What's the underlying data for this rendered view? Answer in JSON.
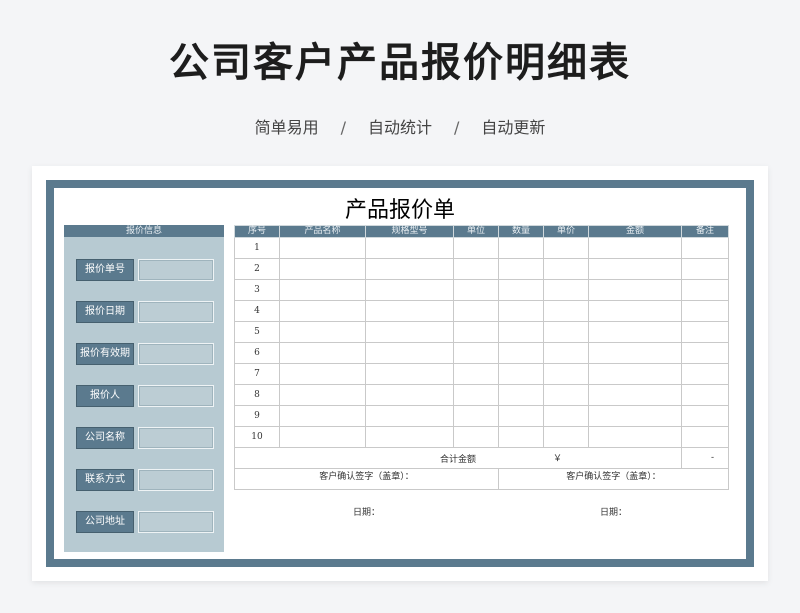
{
  "header": {
    "title": "公司客户产品报价明细表",
    "tags": [
      "简单易用",
      "自动统计",
      "自动更新"
    ],
    "separator": "/"
  },
  "sheet": {
    "title": "产品报价单",
    "info_panel": {
      "heading": "报价信息",
      "fields": [
        {
          "label": "报价单号",
          "value": ""
        },
        {
          "label": "报价日期",
          "value": ""
        },
        {
          "label": "报价有效期",
          "value": ""
        },
        {
          "label": "报价人",
          "value": ""
        },
        {
          "label": "公司名称",
          "value": ""
        },
        {
          "label": "联系方式",
          "value": ""
        },
        {
          "label": "公司地址",
          "value": ""
        }
      ]
    },
    "table": {
      "columns": [
        "序号",
        "产品名称",
        "规格型号",
        "单位",
        "数量",
        "单价",
        "金额",
        "备注"
      ],
      "rows": [
        {
          "no": "1"
        },
        {
          "no": "2"
        },
        {
          "no": "3"
        },
        {
          "no": "4"
        },
        {
          "no": "5"
        },
        {
          "no": "6"
        },
        {
          "no": "7"
        },
        {
          "no": "8"
        },
        {
          "no": "9"
        },
        {
          "no": "10"
        }
      ],
      "total_label": "合计金额",
      "currency_symbol": "￥",
      "total_value": "-"
    },
    "signatures": [
      {
        "label": "客户确认签字（盖章）：",
        "date_label": "日期："
      },
      {
        "label": "客户确认签字（盖章）：",
        "date_label": "日期："
      }
    ]
  },
  "colors": {
    "accent": "#5b7a8e",
    "panel": "#b7cad2",
    "background": "#f4f5f7"
  }
}
